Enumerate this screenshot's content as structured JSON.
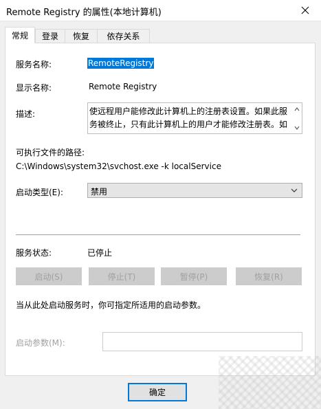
{
  "window": {
    "title": "Remote Registry 的属性(本地计算机)",
    "close_glyph": "✕"
  },
  "tabs": [
    {
      "label": "常规",
      "active": true
    },
    {
      "label": "登录"
    },
    {
      "label": "恢复"
    },
    {
      "label": "依存关系"
    }
  ],
  "general": {
    "service_name_label": "服务名称:",
    "service_name_value": "RemoteRegistry",
    "display_name_label": "显示名称:",
    "display_name_value": "Remote Registry",
    "description_label": "描述:",
    "description_value": "使远程用户能修改此计算机上的注册表设置。如果此服务被终止，只有此计算机上的用户才能修改注册表。如",
    "exe_path_label": "可执行文件的路径:",
    "exe_path_value": "C:\\Windows\\system32\\svchost.exe -k localService",
    "startup_type_label": "启动类型(E):",
    "startup_type_value": "禁用",
    "service_status_label": "服务状态:",
    "service_status_value": "已停止",
    "buttons": {
      "start": "启动(S)",
      "stop": "停止(T)",
      "pause": "暂停(P)",
      "resume": "恢复(R)"
    },
    "hint_text": "当从此处启动服务时，你可指定所适用的启动参数。",
    "start_params_label": "启动参数(M):",
    "start_params_value": ""
  },
  "footer": {
    "ok_label": "确定"
  },
  "colors": {
    "accent": "#0078d7",
    "disabled_text": "#a0a0a0"
  }
}
